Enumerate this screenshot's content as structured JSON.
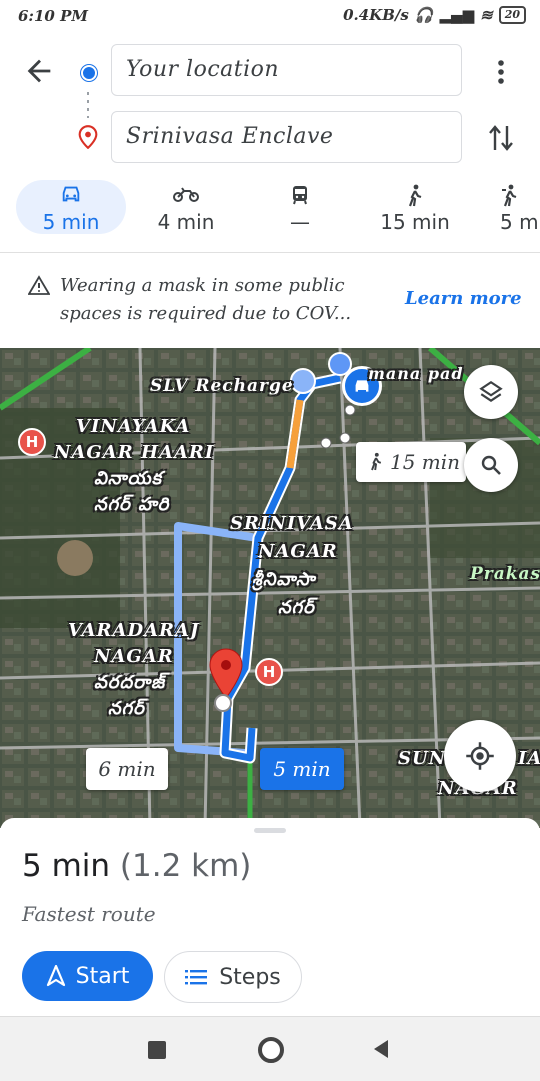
{
  "status_bar": {
    "time": "6:10 PM",
    "network": "0.4KB/s",
    "battery": "20"
  },
  "route": {
    "origin": "Your location",
    "destination": "Srinivasa Enclave"
  },
  "modes": [
    {
      "icon": "car-icon",
      "label": "5 min",
      "selected": true
    },
    {
      "icon": "motorcycle-icon",
      "label": "4 min",
      "selected": false
    },
    {
      "icon": "transit-icon",
      "label": "—",
      "selected": false
    },
    {
      "icon": "walk-icon",
      "label": "15 min",
      "selected": false
    },
    {
      "icon": "ride-icon",
      "label": "5 m",
      "selected": false
    }
  ],
  "notice": {
    "text_line1": "Wearing a mask in some public",
    "text_line2": "spaces is required due to COV...",
    "link": "Learn more"
  },
  "map": {
    "labels": {
      "slv": "SLV Recharge",
      "mana": "mana pad",
      "vinayaka1": "VINAYAKA",
      "vinayaka2": "NAGAR HAARI",
      "vinayaka_te1": "వినాయక",
      "vinayaka_te2": "నగర్ హరి",
      "srinivasa1": "SRINIVASA",
      "srinivasa2": "NAGAR",
      "srinivasa_te1": "శ్రీనివాసా",
      "srinivasa_te2": "నగర్",
      "varadaraj1": "VARADARAJ",
      "varadaraj2": "NAGAR",
      "varadaraj_te1": "వరదరాజ్",
      "varadaraj_te2": "నగర్",
      "prakas": "Prakas",
      "sun1": "SUN",
      "sun2": "NAGAR",
      "sun_ia": "IA"
    },
    "walk_chip": "15 min",
    "alt_route_chip": "6 min",
    "main_route_chip": "5 min",
    "colors": {
      "route": "#1a73e8",
      "alt_route": "#8ab4f8",
      "traffic": "#f6a03b",
      "road_green": "#3cb043"
    }
  },
  "summary": {
    "time": "5 min",
    "distance": "(1.2 km)",
    "subtitle": "Fastest route",
    "start_label": "Start",
    "steps_label": "Steps"
  }
}
